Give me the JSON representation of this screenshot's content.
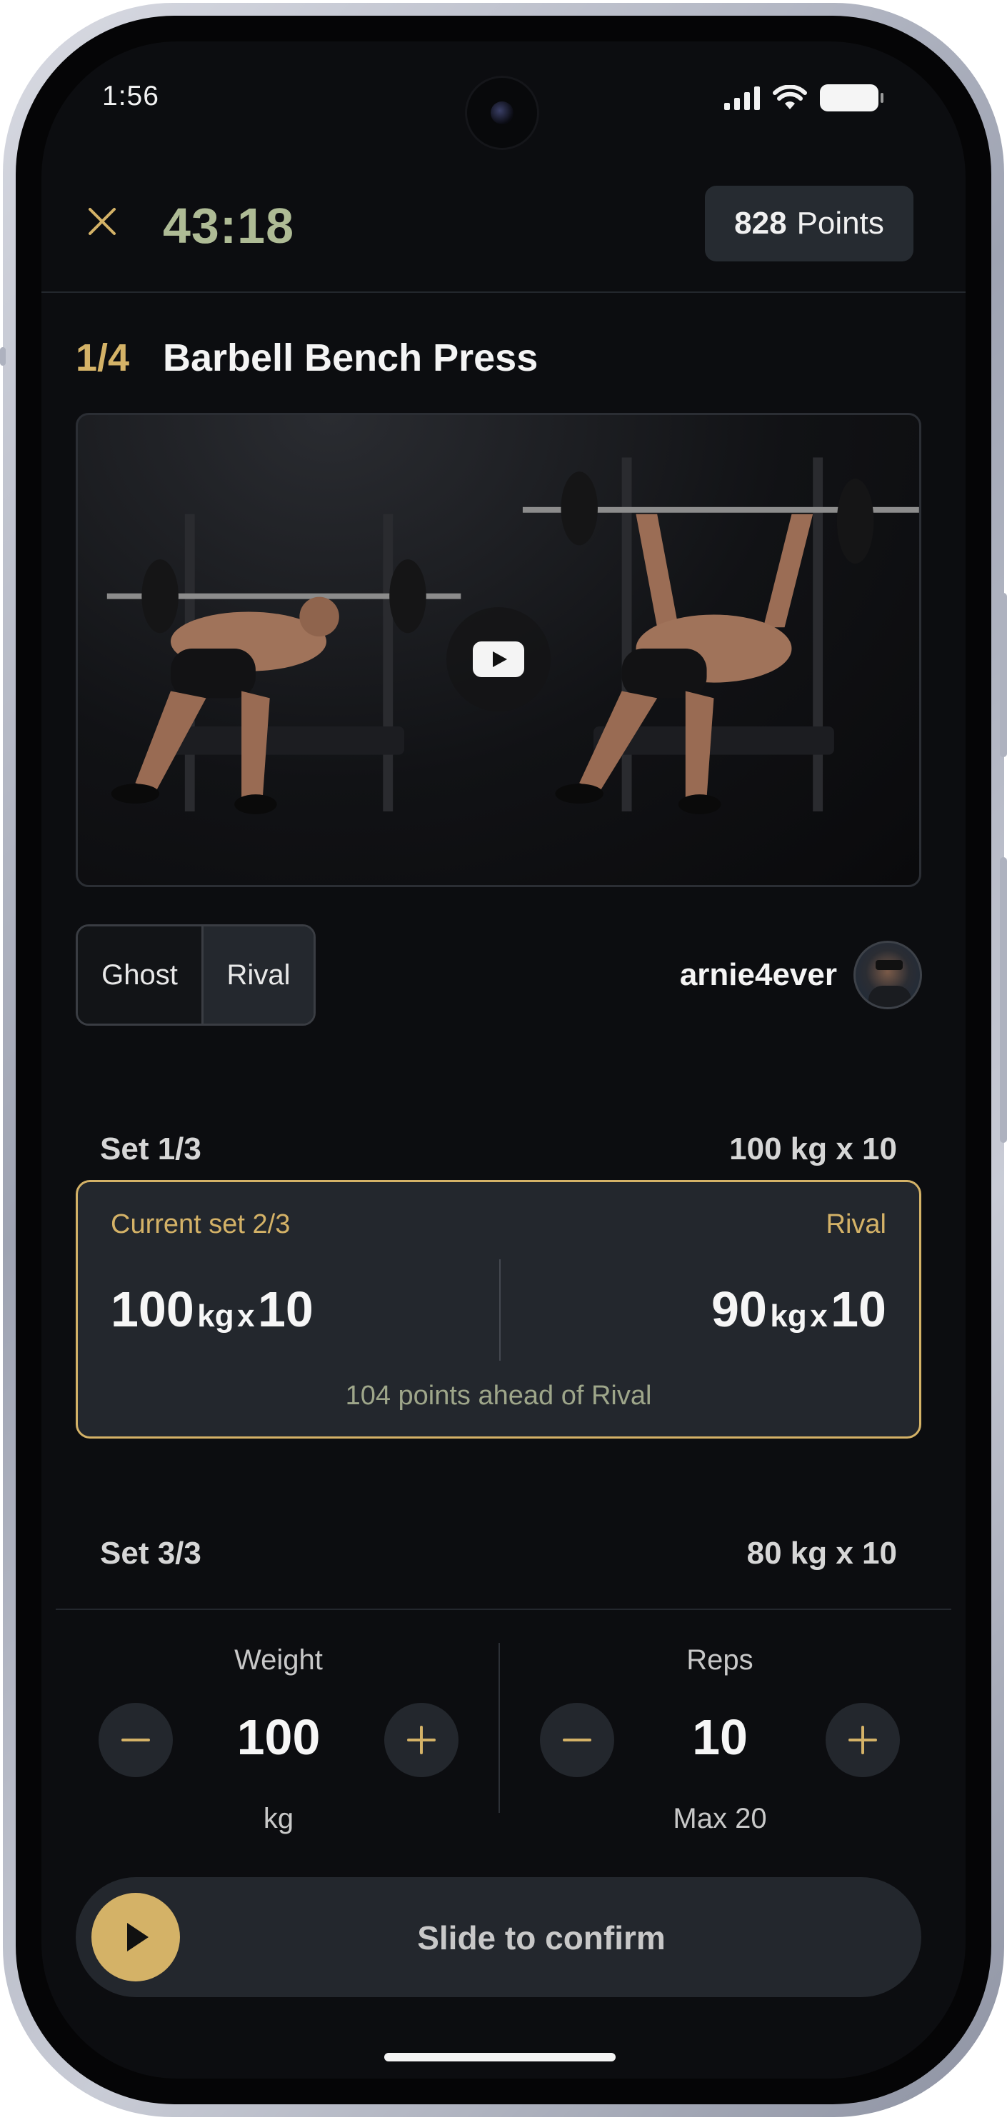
{
  "status_bar": {
    "time": "1:56"
  },
  "header": {
    "timer": "43:18",
    "points_value": "828",
    "points_label": "Points"
  },
  "exercise": {
    "index": "1/4",
    "title": "Barbell Bench Press"
  },
  "mode_toggle": {
    "options": [
      "Ghost",
      "Rival"
    ],
    "selected": "Rival"
  },
  "rival": {
    "username": "arnie4ever"
  },
  "sets": {
    "set1": {
      "label": "Set 1/3",
      "value": "100 kg x 10"
    },
    "current": {
      "label": "Current set 2/3",
      "rival_label": "Rival",
      "user_weight": "100",
      "user_reps": "10",
      "rival_weight": "90",
      "rival_reps": "10",
      "unit": "kg",
      "times": "x",
      "note": "104 points ahead of Rival"
    },
    "set3": {
      "label": "Set 3/3",
      "value": "80 kg x 10"
    }
  },
  "controls": {
    "weight": {
      "label": "Weight",
      "value": "100",
      "unit": "kg"
    },
    "reps": {
      "label": "Reps",
      "value": "10",
      "unit": "Max 20"
    }
  },
  "slider": {
    "label": "Slide to confirm"
  },
  "colors": {
    "accent": "#d4b267",
    "timer": "#aebb95",
    "background": "#0c0d10",
    "card": "#23272d"
  }
}
